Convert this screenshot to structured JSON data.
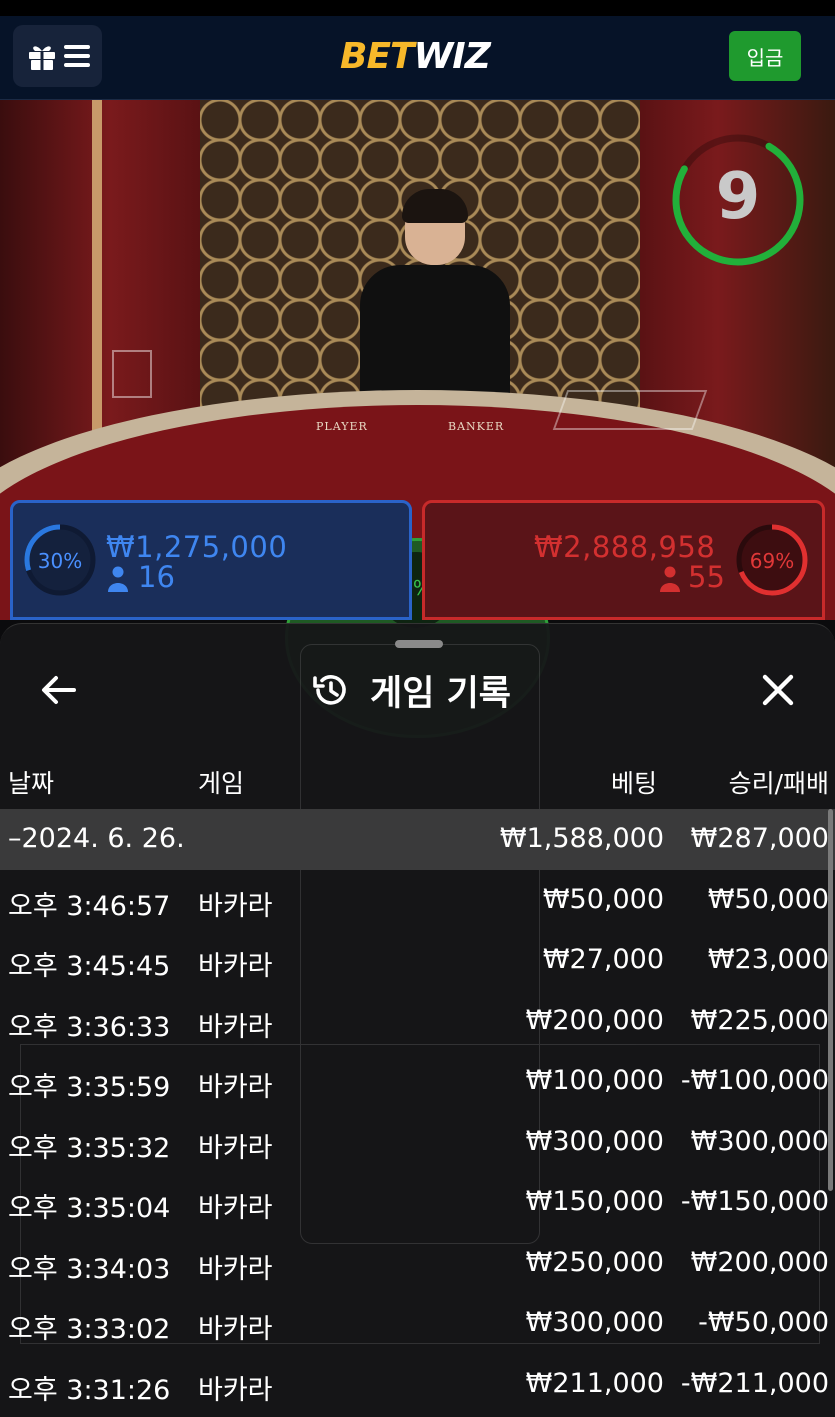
{
  "header": {
    "logo_part1": "BET",
    "logo_part2": "WIZ",
    "deposit_label": "입금"
  },
  "video": {
    "countdown": "9",
    "table_label_player": "PLAYER",
    "table_label_banker": "BANKER",
    "countdown_fraction": 0.75
  },
  "bets": {
    "player": {
      "percent": "30%",
      "amount": "₩1,275,000",
      "count": "16",
      "percent_value": 0.3
    },
    "banker": {
      "percent": "69%",
      "amount": "₩2,888,958",
      "count": "55",
      "percent_value": 0.69
    },
    "tie": {
      "percent": "1%"
    }
  },
  "sheet": {
    "title": "게임 기록",
    "columns": {
      "date": "날짜",
      "game": "게임",
      "bet": "베팅",
      "result": "승리/패배"
    },
    "summary": {
      "date": "–2024. 6. 26.",
      "bet": "₩1,588,000",
      "result": "₩287,000"
    },
    "records": [
      {
        "time": "오후 3:46:57",
        "game": "바카라",
        "bet": "₩50,000",
        "result": "₩50,000"
      },
      {
        "time": "오후 3:45:45",
        "game": "바카라",
        "bet": "₩27,000",
        "result": "₩23,000"
      },
      {
        "time": "오후 3:36:33",
        "game": "바카라",
        "bet": "₩200,000",
        "result": "₩225,000"
      },
      {
        "time": "오후 3:35:59",
        "game": "바카라",
        "bet": "₩100,000",
        "result": "-₩100,000"
      },
      {
        "time": "오후 3:35:32",
        "game": "바카라",
        "bet": "₩300,000",
        "result": "₩300,000"
      },
      {
        "time": "오후 3:35:04",
        "game": "바카라",
        "bet": "₩150,000",
        "result": "-₩150,000"
      },
      {
        "time": "오후 3:34:03",
        "game": "바카라",
        "bet": "₩250,000",
        "result": "₩200,000"
      },
      {
        "time": "오후 3:33:02",
        "game": "바카라",
        "bet": "₩300,000",
        "result": "-₩50,000"
      },
      {
        "time": "오후 3:31:26",
        "game": "바카라",
        "bet": "₩211,000",
        "result": "-₩211,000"
      }
    ]
  },
  "icons": {
    "menu": "gift-icon",
    "menu2": "hamburger-icon",
    "back": "arrow-left-icon",
    "close": "close-icon",
    "history": "history-icon",
    "person": "person-icon"
  },
  "colors": {
    "brand_yellow": "#f7b82a",
    "deposit_green": "#1f9a2e",
    "player_blue": "#2a63c9",
    "banker_red": "#c72a2a",
    "tie_green": "#2fa03a",
    "timer_green": "#22b03a"
  }
}
